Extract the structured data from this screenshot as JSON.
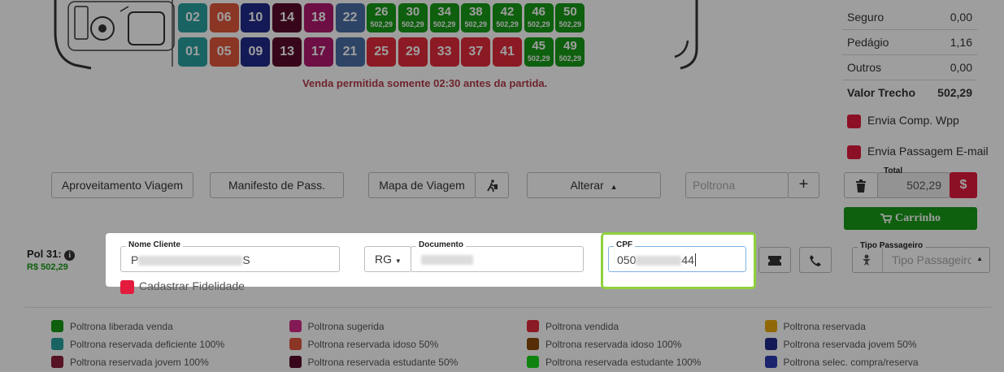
{
  "bus": {
    "upper_row": [
      {
        "num": "02",
        "color": "#2aa0a0",
        "price": ""
      },
      {
        "num": "06",
        "color": "#e0563c",
        "price": ""
      },
      {
        "num": "10",
        "color": "#1f2a8a",
        "price": ""
      },
      {
        "num": "14",
        "color": "#5a0a2a",
        "price": ""
      },
      {
        "num": "18",
        "color": "#b0196e",
        "price": ""
      },
      {
        "num": "22",
        "color": "#4a6fa5",
        "price": ""
      },
      {
        "num": "26",
        "color": "#179a17",
        "price": "502,29"
      },
      {
        "num": "30",
        "color": "#179a17",
        "price": "502,29"
      },
      {
        "num": "34",
        "color": "#179a17",
        "price": "502,29"
      },
      {
        "num": "38",
        "color": "#179a17",
        "price": "502,29"
      },
      {
        "num": "42",
        "color": "#179a17",
        "price": "502,29"
      },
      {
        "num": "46",
        "color": "#179a17",
        "price": "502,29"
      },
      {
        "num": "50",
        "color": "#179a17",
        "price": "502,29"
      }
    ],
    "lower_row": [
      {
        "num": "01",
        "color": "#2aa0a0",
        "price": ""
      },
      {
        "num": "05",
        "color": "#e0563c",
        "price": ""
      },
      {
        "num": "09",
        "color": "#1f2a8a",
        "price": ""
      },
      {
        "num": "13",
        "color": "#5a0a2a",
        "price": ""
      },
      {
        "num": "17",
        "color": "#b0196e",
        "price": ""
      },
      {
        "num": "21",
        "color": "#4a6fa5",
        "price": ""
      },
      {
        "num": "25",
        "color": "#e02a3a",
        "price": ""
      },
      {
        "num": "29",
        "color": "#e02a3a",
        "price": ""
      },
      {
        "num": "33",
        "color": "#e02a3a",
        "price": ""
      },
      {
        "num": "37",
        "color": "#e02a3a",
        "price": ""
      },
      {
        "num": "41",
        "color": "#e02a3a",
        "price": ""
      },
      {
        "num": "45",
        "color": "#179a17",
        "price": "502,29"
      },
      {
        "num": "49",
        "color": "#179a17",
        "price": "502,29"
      }
    ],
    "notice": "Venda permitida somente 02:30 antes da partida."
  },
  "summary": {
    "rows": [
      {
        "label": "Seguro",
        "value": "0,00"
      },
      {
        "label": "Pedágio",
        "value": "1,16"
      },
      {
        "label": "Outros",
        "value": "0,00"
      },
      {
        "label": "Valor Trecho",
        "value": "502,29"
      }
    ],
    "send_receipt_label": "Envia Comp. Wpp",
    "send_ticket_label": "Envia Passagem E-mail",
    "total_label": "Total",
    "total_value": "502,29",
    "cart_label": "Carrinho",
    "accent": "#e31b3c",
    "cart_color": "#179a17"
  },
  "toolbar": {
    "aproveitamento": "Aproveitamento Viagem",
    "manifesto": "Manifesto de Pass.",
    "mapa": "Mapa de Viagem",
    "alterar": "Alterar",
    "poltrona_placeholder": "Poltrona",
    "add_symbol": "+"
  },
  "passenger": {
    "seat_label": "Pol 31:",
    "seat_price": "R$ 502,29",
    "name_label": "Nome Cliente",
    "name_start": "P",
    "name_end": "S",
    "doc_type": "RG",
    "doc_label": "Documento",
    "cpf_label": "CPF",
    "cpf_start": "050",
    "cpf_end": "44",
    "fidelity_label": "Cadastrar Fidelidade",
    "type_label": "Tipo Passageiro",
    "type_placeholder": "Tipo Passageiro"
  },
  "legend": [
    {
      "label": "Poltrona liberada venda",
      "color": "#179a17"
    },
    {
      "label": "Poltrona reservada deficiente 100%",
      "color": "#2aa0a0"
    },
    {
      "label": "Poltrona reservada jovem 100%",
      "color": "#8a1f3a"
    },
    {
      "label": "Poltrona sugerida",
      "color": "#d62a8a"
    },
    {
      "label": "Poltrona reservada idoso 50%",
      "color": "#e0563c"
    },
    {
      "label": "Poltrona reservada estudante 50%",
      "color": "#5a0a2a"
    },
    {
      "label": "Poltrona vendida",
      "color": "#e02a3a"
    },
    {
      "label": "Poltrona reservada idoso 100%",
      "color": "#8a4a0a"
    },
    {
      "label": "Poltrona reservada estudante 100%",
      "color": "#18d618"
    },
    {
      "label": "Poltrona reservada",
      "color": "#e8a80a"
    },
    {
      "label": "Poltrona reservada jovem 50%",
      "color": "#1f2a8a"
    },
    {
      "label": "Poltrona selec. compra/reserva",
      "color": "#2a3ab0"
    }
  ]
}
